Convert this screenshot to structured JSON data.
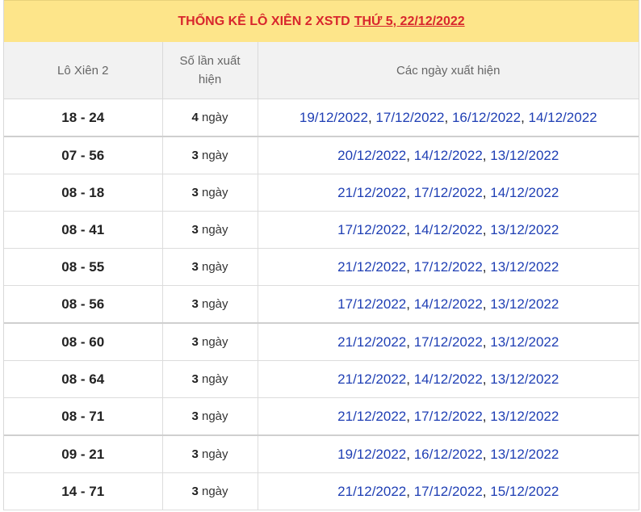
{
  "header": {
    "title_prefix": "THỐNG KÊ LÔ XIÊN 2 XSTD",
    "title_link": "THỨ 5, 22/12/2022"
  },
  "columns": {
    "pair": "Lô Xiên 2",
    "count": "Số lần xuất hiện",
    "dates": "Các ngày xuất hiện"
  },
  "day_unit": "ngày",
  "separator": ", ",
  "rows": [
    {
      "pair": "18 - 24",
      "count": "4",
      "dates": [
        "19/12/2022",
        "17/12/2022",
        "16/12/2022",
        "14/12/2022"
      ]
    },
    {
      "pair": "07 - 56",
      "count": "3",
      "dates": [
        "20/12/2022",
        "14/12/2022",
        "13/12/2022"
      ]
    },
    {
      "pair": "08 - 18",
      "count": "3",
      "dates": [
        "21/12/2022",
        "17/12/2022",
        "14/12/2022"
      ]
    },
    {
      "pair": "08 - 41",
      "count": "3",
      "dates": [
        "17/12/2022",
        "14/12/2022",
        "13/12/2022"
      ]
    },
    {
      "pair": "08 - 55",
      "count": "3",
      "dates": [
        "21/12/2022",
        "17/12/2022",
        "13/12/2022"
      ]
    },
    {
      "pair": "08 - 56",
      "count": "3",
      "dates": [
        "17/12/2022",
        "14/12/2022",
        "13/12/2022"
      ]
    },
    {
      "pair": "08 - 60",
      "count": "3",
      "dates": [
        "21/12/2022",
        "17/12/2022",
        "13/12/2022"
      ]
    },
    {
      "pair": "08 - 64",
      "count": "3",
      "dates": [
        "21/12/2022",
        "14/12/2022",
        "13/12/2022"
      ]
    },
    {
      "pair": "08 - 71",
      "count": "3",
      "dates": [
        "21/12/2022",
        "17/12/2022",
        "13/12/2022"
      ]
    },
    {
      "pair": "09 - 21",
      "count": "3",
      "dates": [
        "19/12/2022",
        "16/12/2022",
        "13/12/2022"
      ]
    },
    {
      "pair": "14 - 71",
      "count": "3",
      "dates": [
        "21/12/2022",
        "17/12/2022",
        "15/12/2022"
      ]
    }
  ],
  "colors": {
    "title_bg": "#fde58a",
    "title_text": "#d8262d",
    "date_link": "#1f3fb4",
    "header_bg": "#f2f2f2"
  }
}
